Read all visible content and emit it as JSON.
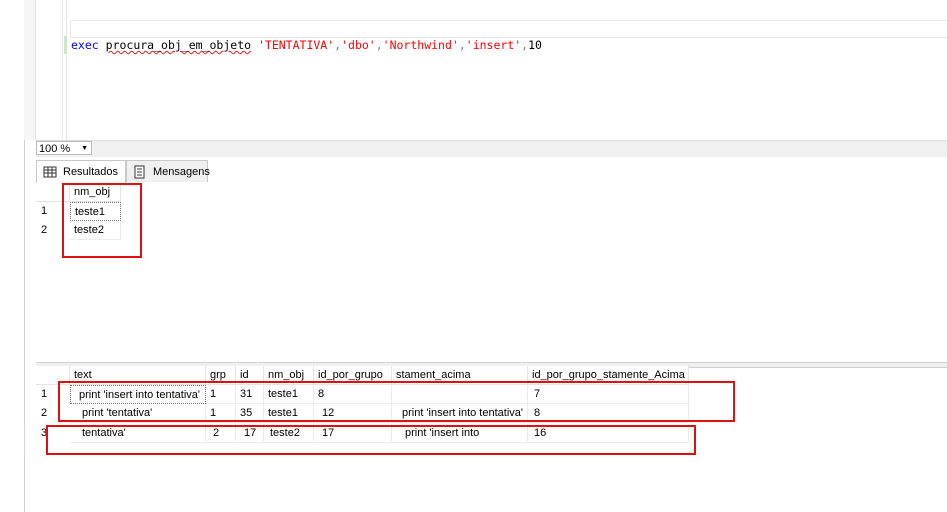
{
  "editor": {
    "code": {
      "keyword": "exec",
      "procedure": "procura_obj_em_objeto",
      "args": [
        "'TENTATIVA'",
        "'dbo'",
        "'Northwind'",
        "'insert'"
      ],
      "last_arg": "10"
    }
  },
  "zoom": {
    "value": "100 %"
  },
  "tabs": [
    {
      "label": "Resultados"
    },
    {
      "label": "Mensagens"
    }
  ],
  "grid1": {
    "headers": [
      "nm_obj"
    ],
    "rows": [
      {
        "num": "1",
        "cells": [
          "teste1"
        ]
      },
      {
        "num": "2",
        "cells": [
          "teste2"
        ]
      }
    ]
  },
  "grid2": {
    "headers": [
      "text",
      "grp",
      "id",
      "nm_obj",
      "id_por_grupo",
      "stament_acima",
      "id_por_grupo_stamente_Acima"
    ],
    "rows": [
      {
        "num": "1",
        "cells": [
          "print 'insert into tentativa'",
          "1",
          "31",
          "teste1",
          "8",
          "",
          "7"
        ]
      },
      {
        "num": "2",
        "cells": [
          "print 'tentativa'",
          "1",
          "35",
          "teste1",
          "12",
          "print 'insert into tentativa'",
          "8"
        ]
      },
      {
        "num": "3",
        "cells": [
          "tentativa'",
          "2",
          "17",
          "teste2",
          "17",
          "print 'insert into",
          "16"
        ]
      }
    ]
  },
  "colors": {
    "highlight_box": "#e01010",
    "keyword": "#0000ff",
    "string": "#ff0000"
  }
}
